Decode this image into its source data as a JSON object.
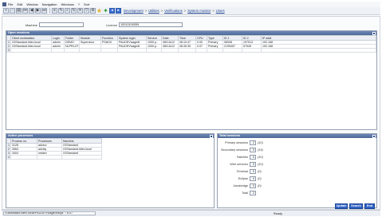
{
  "menubar": {
    "items": [
      "File",
      "Edit",
      "Window",
      "Navigation",
      "Windows",
      "?",
      "Sort"
    ]
  },
  "toolbar": {
    "breadcrumb": [
      "Development",
      "Utilities",
      "Verifications",
      "System monitor",
      "Users"
    ]
  },
  "header": {
    "machine_label": "Machine",
    "machine_value": "",
    "licence_label": "Licence",
    "licence_value": "10010100059"
  },
  "open_sessions": {
    "title": "Open sessions",
    "columns": [
      "Client workstation",
      "Login",
      "Folder",
      "Module",
      "Function",
      "System login",
      "Service",
      "Date",
      "Time",
      "CPU",
      "Type",
      "ID 1",
      "ID 2",
      "IP addr"
    ],
    "rows": [
      {
        "n": "1",
        "cells": [
          "X3Standard.ildev.local",
          "admin",
          "DEMO",
          "Supervisor",
          "PSADX",
          "PAUDEV\\sagedt",
          "1000.p..",
          "08/CA/12",
          "08:10:47",
          "0.00",
          "Primary",
          "98308",
          "197513",
          "192.168"
        ]
      },
      {
        "n": "2",
        "cells": [
          "X3Standard.ildev.local",
          "admin",
          "NLPRLOT",
          "",
          "",
          "PAUDEV\\sagedt",
          "1000.p..",
          "08/CA/12",
          "08:35:35",
          "0.07",
          "Primary",
          "2195457",
          "57545",
          "192.168"
        ]
      },
      {
        "n": "3",
        "cells": [
          "",
          "",
          "",
          "",
          "",
          "",
          "",
          "",
          "",
          "",
          "",
          "",
          "",
          ""
        ]
      }
    ]
  },
  "active_processes": {
    "title": "Active processes",
    "columns": [
      "Process no.",
      "Processes",
      "Machine"
    ],
    "rows": [
      {
        "n": "1",
        "cells": [
          "3128",
          "adxsrv",
          "X3Standard"
        ]
      },
      {
        "n": "2",
        "cells": [
          "2664",
          "adxlsy",
          "X3Standard.ildev.local"
        ]
      },
      {
        "n": "3",
        "cells": [
          "3404",
          "netdev",
          "X3Standard"
        ]
      },
      {
        "n": "4",
        "cells": [
          "",
          "",
          ""
        ]
      }
    ]
  },
  "total_sessions": {
    "title": "Total sessions",
    "rows": [
      {
        "label": "Primary sessions",
        "value": "2",
        "extra": "(10)"
      },
      {
        "label": "Secondary sessions",
        "value": "0",
        "extra": "(15)"
      },
      {
        "label": "Batches",
        "value": "0",
        "extra": "(10)"
      },
      {
        "label": "Web services",
        "value": "0",
        "extra": "(10)"
      },
      {
        "label": "Terminal",
        "value": "0",
        "extra": "(0)"
      },
      {
        "label": "Eclipse",
        "value": "0",
        "extra": "(0)"
      },
      {
        "label": "Javabridge",
        "value": "0",
        "extra": "(0)"
      },
      {
        "label": "Total",
        "value": "2",
        "extra": ""
      }
    ]
  },
  "buttons": {
    "update": "Update",
    "search": "Search",
    "end": "End"
  },
  "statusbar": {
    "path": "X3standard.ildev.local\\PAUDEV\\sagedt\\sqlx :: 8.07",
    "ready": "Ready"
  },
  "colors": {
    "panel_header": "#4d6897",
    "action_button": "#2f62c4"
  }
}
